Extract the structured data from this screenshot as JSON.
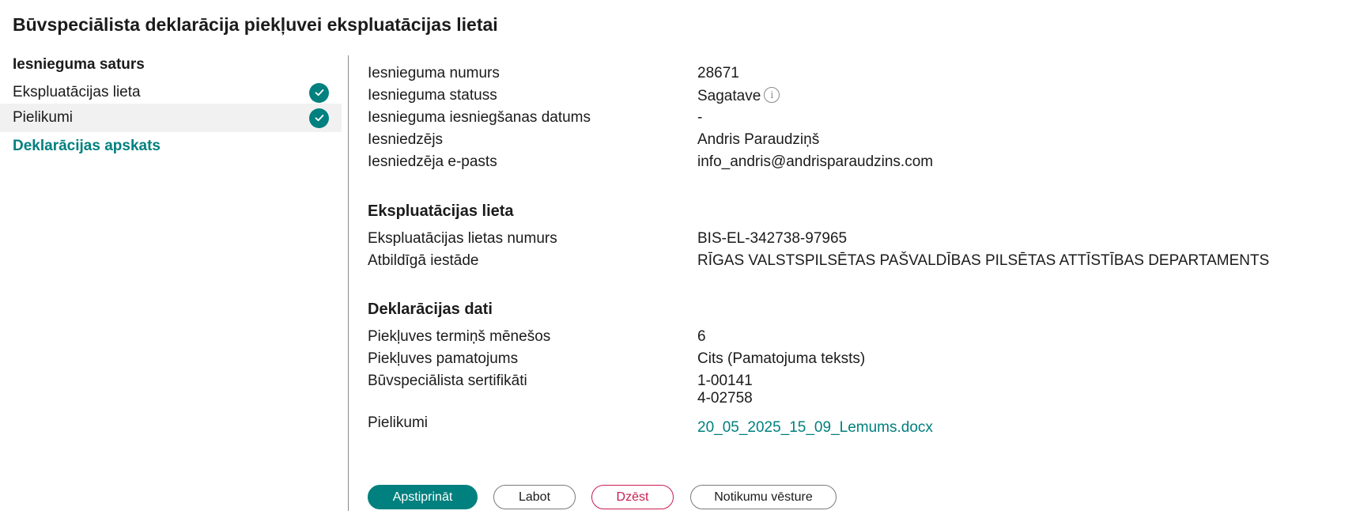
{
  "page": {
    "title": "Būvspeciālista deklarācija piekļuvei ekspluatācijas lietai"
  },
  "sidebar": {
    "heading": "Iesnieguma saturs",
    "items": [
      {
        "label": "Ekspluatācijas lieta",
        "completed": true
      },
      {
        "label": "Pielikumi",
        "completed": true
      },
      {
        "label": "Deklarācijas apskats",
        "completed": false
      }
    ]
  },
  "submission": {
    "rows": [
      {
        "label": "Iesnieguma numurs",
        "value": "28671"
      },
      {
        "label": "Iesnieguma statuss",
        "value": "Sagatave"
      },
      {
        "label": "Iesnieguma iesniegšanas datums",
        "value": "-"
      },
      {
        "label": "Iesniedzējs",
        "value": "Andris Paraudziņš"
      },
      {
        "label": "Iesniedzēja e-pasts",
        "value": "info_andris@andrisparaudzins.com"
      }
    ],
    "status_info_icon": "info-icon"
  },
  "case": {
    "title": "Ekspluatācijas lieta",
    "rows": [
      {
        "label": "Ekspluatācijas lietas numurs",
        "value": "BIS-EL-342738-97965"
      },
      {
        "label": "Atbildīgā iestāde",
        "value": "RĪGAS VALSTSPILSĒTAS PAŠVALDĪBAS PILSĒTAS ATTĪSTĪBAS DEPARTAMENTS"
      }
    ]
  },
  "declaration": {
    "title": "Deklarācijas dati",
    "rows": [
      {
        "label": "Piekļuves termiņš mēnešos",
        "value": "6"
      },
      {
        "label": "Piekļuves pamatojums",
        "value": "Cits (Pamatojuma teksts)"
      }
    ],
    "certificates": {
      "label": "Būvspeciālista sertifikāti",
      "values": [
        "1-00141",
        "4-02758"
      ]
    },
    "attachments": {
      "label": "Pielikumi",
      "file": "20_05_2025_15_09_Lemums.docx"
    }
  },
  "actions": {
    "confirm": "Apstiprināt",
    "edit": "Labot",
    "delete": "Dzēst",
    "history": "Notikumu vēsture"
  },
  "colors": {
    "accent": "#00807e",
    "danger": "#c81e50",
    "selected_bg": "#f1f1f1"
  }
}
